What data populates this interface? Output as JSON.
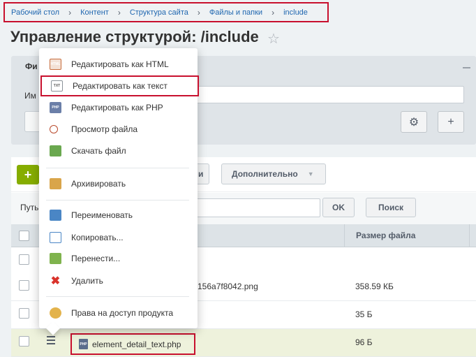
{
  "breadcrumb": {
    "items": [
      "Рабочий стол",
      "Контент",
      "Структура сайта",
      "Файлы и папки",
      "include"
    ],
    "separator": "›"
  },
  "page": {
    "title": "Управление структурой: /include"
  },
  "filter": {
    "tab_label": "Фи",
    "field_label": "Им"
  },
  "toolbar": {
    "add_label": "+",
    "more_label": "Дополнительно",
    "hidden_btn_fragment": "и"
  },
  "path_bar": {
    "label": "Путь",
    "ok_label": "OK",
    "search_label": "Поиск"
  },
  "grid": {
    "size_header": "Размер файла",
    "rows": [
      {
        "name": "",
        "size": ""
      },
      {
        "name": "156a7f8042.png",
        "size": "358.59 КБ"
      },
      {
        "name": "",
        "size": "35 Б"
      },
      {
        "name": "element_detail_text.php",
        "size": "96 Б"
      }
    ]
  },
  "context_menu": {
    "items": [
      {
        "label": "Редактировать как HTML",
        "icon": "html-file-icon",
        "icon_text": "HTML"
      },
      {
        "label": "Редактировать как текст",
        "icon": "txt-file-icon",
        "icon_text": "TXT",
        "highlighted": true
      },
      {
        "label": "Редактировать как PHP",
        "icon": "php-file-icon",
        "icon_text": "PHP"
      },
      {
        "label": "Просмотр файла",
        "icon": "magnifier-icon"
      },
      {
        "label": "Скачать файл",
        "icon": "download-icon"
      },
      {
        "label": "Архивировать",
        "icon": "archive-icon"
      },
      {
        "label": "Переименовать",
        "icon": "rename-icon"
      },
      {
        "label": "Копировать...",
        "icon": "copy-icon"
      },
      {
        "label": "Перенести...",
        "icon": "move-icon"
      },
      {
        "label": "Удалить",
        "icon": "delete-icon",
        "icon_text": "✖"
      },
      {
        "label": "Права на доступ продукта",
        "icon": "permissions-icon"
      }
    ]
  },
  "colors": {
    "highlight_border": "#c8102e",
    "link": "#2067b0",
    "add_button": "#86ad00"
  }
}
